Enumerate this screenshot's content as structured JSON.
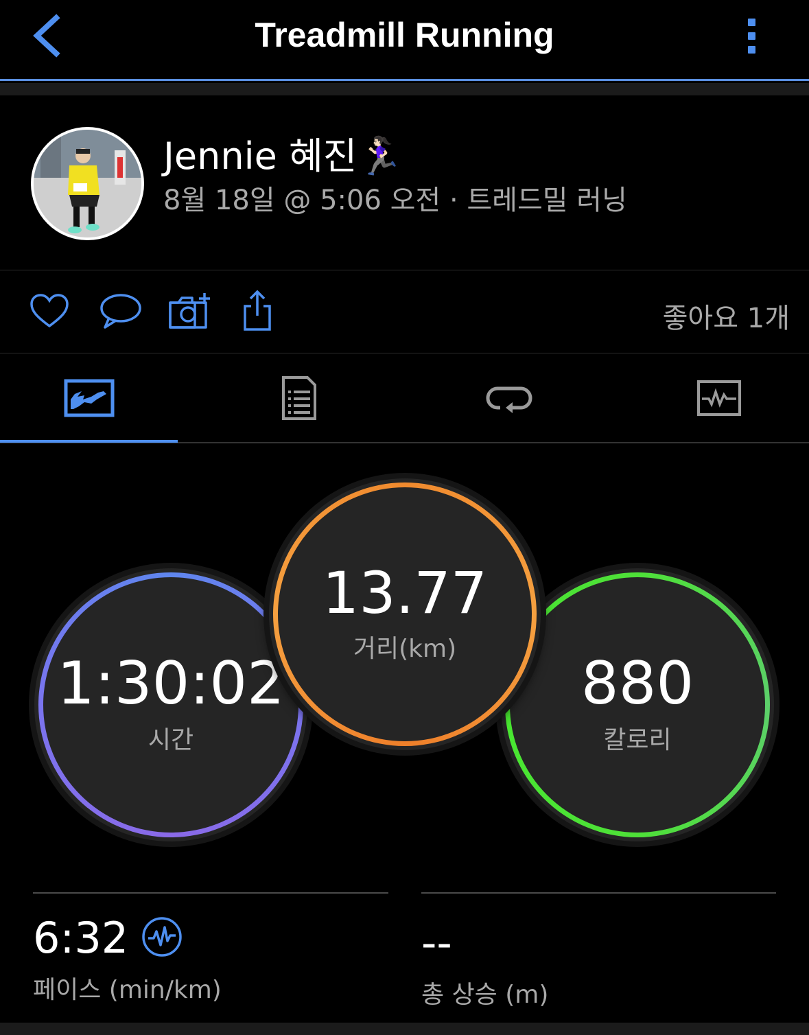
{
  "header": {
    "title": "Treadmill Running",
    "back_icon": "chevron-left-icon",
    "more_icon": "more-vertical-icon",
    "accent_color": "#4e8ff0"
  },
  "profile": {
    "name": "Jennie 혜진🏃🏻‍♀️",
    "meta": "8월 18일 @ 5:06 오전 · 트레드밀 러닝"
  },
  "actions": {
    "icons": [
      "heart-icon",
      "comment-icon",
      "camera-add-icon",
      "share-icon"
    ],
    "likes": "좋아요 1개"
  },
  "tabs": {
    "items": [
      "overview-tab",
      "details-tab",
      "laps-tab",
      "chart-tab"
    ],
    "active_index": 0
  },
  "stats": {
    "time": {
      "value": "1:30:02",
      "label": "시간",
      "color": "#6f7df0"
    },
    "distance": {
      "value": "13.77",
      "label": "거리(km)",
      "color": "#f08a2e"
    },
    "calories": {
      "value": "880",
      "label": "칼로리",
      "color": "#4ee038"
    }
  },
  "bottom": {
    "pace": {
      "value": "6:32",
      "label": "페이스 (min/km)"
    },
    "ascent": {
      "value": "--",
      "label": "총 상승 (m)"
    }
  }
}
